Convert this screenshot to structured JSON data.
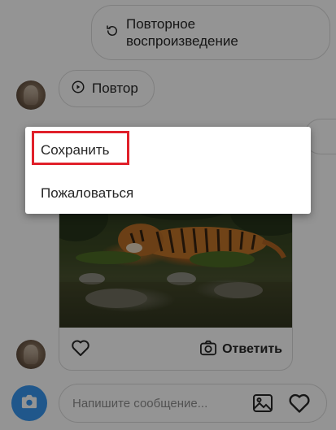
{
  "thread": {
    "replay_full_label": "Повторное\nвоспроизведение",
    "replay_full_line1": "Повторное",
    "replay_full_line2": "воспроизведение",
    "replay_label": "Повтор",
    "reply_label": "Ответить"
  },
  "composer": {
    "placeholder": "Напишите сообщение..."
  },
  "context_menu": {
    "items": [
      {
        "label": "Сохранить",
        "highlighted": true
      },
      {
        "label": "Пожаловаться",
        "highlighted": false
      }
    ],
    "highlight_color": "#e0202a"
  },
  "icons": {
    "replay": "replay-icon",
    "play": "play-circle-icon",
    "heart": "heart-icon",
    "camera": "camera-icon",
    "gallery": "gallery-icon"
  },
  "colors": {
    "accent": "#3897f0",
    "border": "#dbdbdb"
  }
}
